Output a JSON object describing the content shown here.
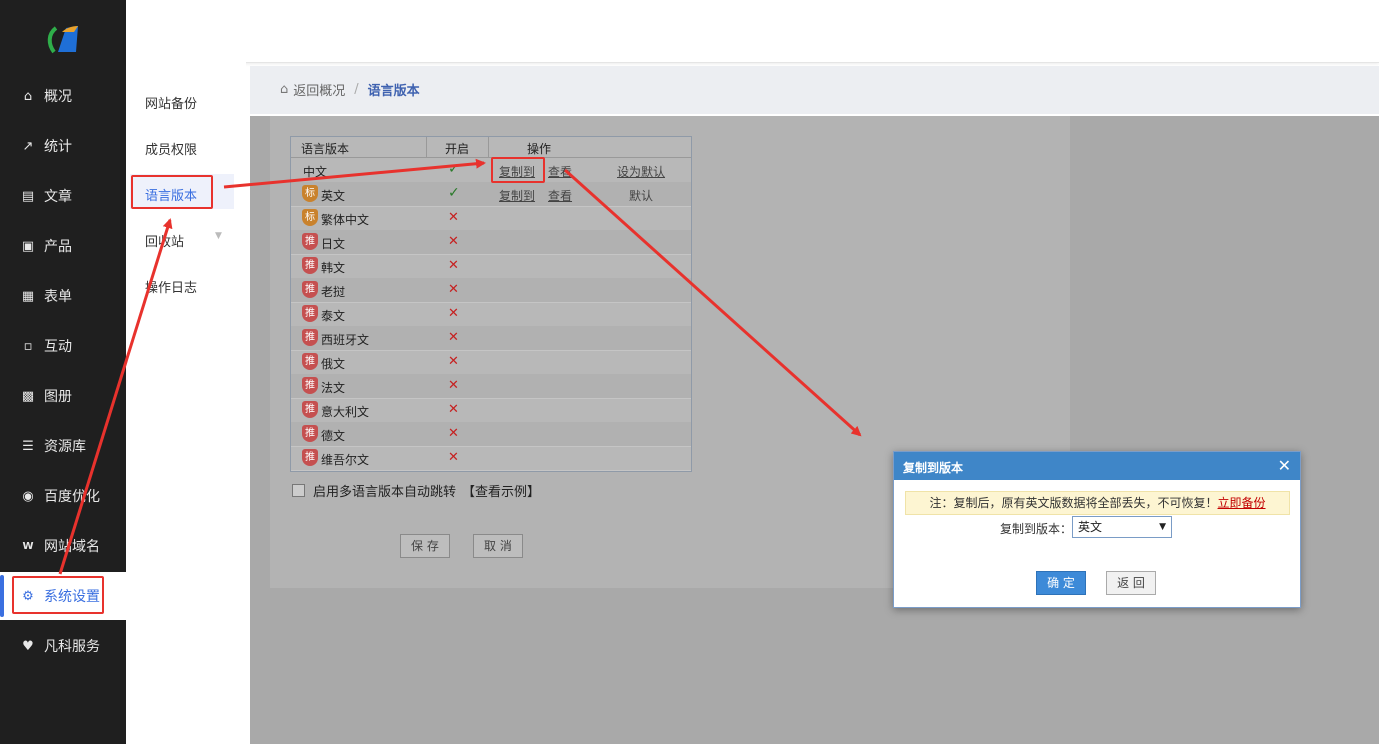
{
  "sidebar": {
    "items": [
      {
        "label": "概况",
        "icon": "home-icon"
      },
      {
        "label": "统计",
        "icon": "stats-icon"
      },
      {
        "label": "文章",
        "icon": "article-icon"
      },
      {
        "label": "产品",
        "icon": "product-icon"
      },
      {
        "label": "表单",
        "icon": "form-icon"
      },
      {
        "label": "互动",
        "icon": "chat-icon"
      },
      {
        "label": "图册",
        "icon": "gallery-icon"
      },
      {
        "label": "资源库",
        "icon": "database-icon"
      },
      {
        "label": "百度优化",
        "icon": "seo-icon"
      },
      {
        "label": "网站域名",
        "icon": "domain-icon"
      },
      {
        "label": "系统设置",
        "icon": "gear-icon"
      },
      {
        "label": "凡科服务",
        "icon": "heart-icon"
      }
    ],
    "active": "系统设置",
    "accent": "#3a6fe0"
  },
  "subnav": {
    "items": [
      "网站备份",
      "成员权限",
      "语言版本",
      "回收站",
      "操作日志"
    ],
    "active": "语言版本"
  },
  "breadcrumb": {
    "back": "返回概况",
    "separator": "/",
    "current": "语言版本"
  },
  "table": {
    "headers": {
      "lang": "语言版本",
      "enabled": "开启",
      "ops": "操作"
    },
    "rows": [
      {
        "name": "中文",
        "badge": "",
        "enabled": true,
        "ops": [
          "复制到",
          "查看",
          "设为默认"
        ]
      },
      {
        "name": "英文",
        "badge": "标",
        "enabled": true,
        "ops": [
          "复制到",
          "查看",
          "默认"
        ]
      },
      {
        "name": "繁体中文",
        "badge": "标",
        "enabled": false,
        "ops": []
      },
      {
        "name": "日文",
        "badge": "推",
        "enabled": false,
        "ops": []
      },
      {
        "name": "韩文",
        "badge": "推",
        "enabled": false,
        "ops": []
      },
      {
        "name": "老挝",
        "badge": "推",
        "enabled": false,
        "ops": []
      },
      {
        "name": "泰文",
        "badge": "推",
        "enabled": false,
        "ops": []
      },
      {
        "name": "西班牙文",
        "badge": "推",
        "enabled": false,
        "ops": []
      },
      {
        "name": "俄文",
        "badge": "推",
        "enabled": false,
        "ops": []
      },
      {
        "name": "法文",
        "badge": "推",
        "enabled": false,
        "ops": []
      },
      {
        "name": "意大利文",
        "badge": "推",
        "enabled": false,
        "ops": []
      },
      {
        "name": "德文",
        "badge": "推",
        "enabled": false,
        "ops": []
      },
      {
        "name": "维吾尔文",
        "badge": "推",
        "enabled": false,
        "ops": []
      }
    ]
  },
  "autojump": {
    "label": "启用多语言版本自动跳转",
    "example": "【查看示例】"
  },
  "buttons": {
    "save": "保 存",
    "cancel": "取 消"
  },
  "dialog": {
    "title": "复制到版本",
    "close": "✕",
    "note": "注：复制后，原有英文版数据将全部丢失，不可恢复！",
    "note_link": "立即备份",
    "label": "复制到版本：",
    "selected": "英文",
    "ok": "确 定",
    "back": "返 回"
  },
  "colors": {
    "annotation_red": "#e8322d",
    "dialog_blue": "#3f86c8"
  }
}
